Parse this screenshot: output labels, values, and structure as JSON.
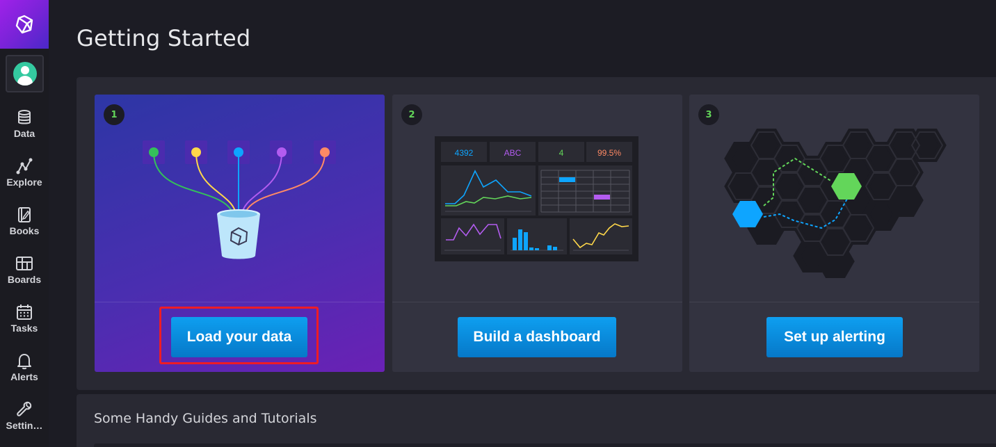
{
  "page": {
    "title": "Getting Started"
  },
  "sidebar": {
    "items": [
      {
        "label": "Data",
        "icon": "database-icon"
      },
      {
        "label": "Explore",
        "icon": "graph-nodes-icon"
      },
      {
        "label": "Books",
        "icon": "notebook-icon"
      },
      {
        "label": "Boards",
        "icon": "dashboard-grid-icon"
      },
      {
        "label": "Tasks",
        "icon": "calendar-icon"
      },
      {
        "label": "Alerts",
        "icon": "bell-icon"
      },
      {
        "label": "Settin…",
        "icon": "wrench-icon"
      }
    ]
  },
  "steps": [
    {
      "number": "1",
      "button": "Load your data"
    },
    {
      "number": "2",
      "button": "Build a dashboard"
    },
    {
      "number": "3",
      "button": "Set up alerting"
    }
  ],
  "dashboard_preview": {
    "stats": [
      "4392",
      "ABC",
      "4",
      "99.5%"
    ]
  },
  "guides": {
    "title": "Some Handy Guides and Tutorials"
  },
  "colors": {
    "accent": "#0e9ff0",
    "step_number": "#63d65a",
    "highlight": "#ee1c25",
    "nodes": [
      "#34c05a",
      "#ffd84a",
      "#0ea5ff",
      "#b35cf0",
      "#ff8a65"
    ]
  }
}
